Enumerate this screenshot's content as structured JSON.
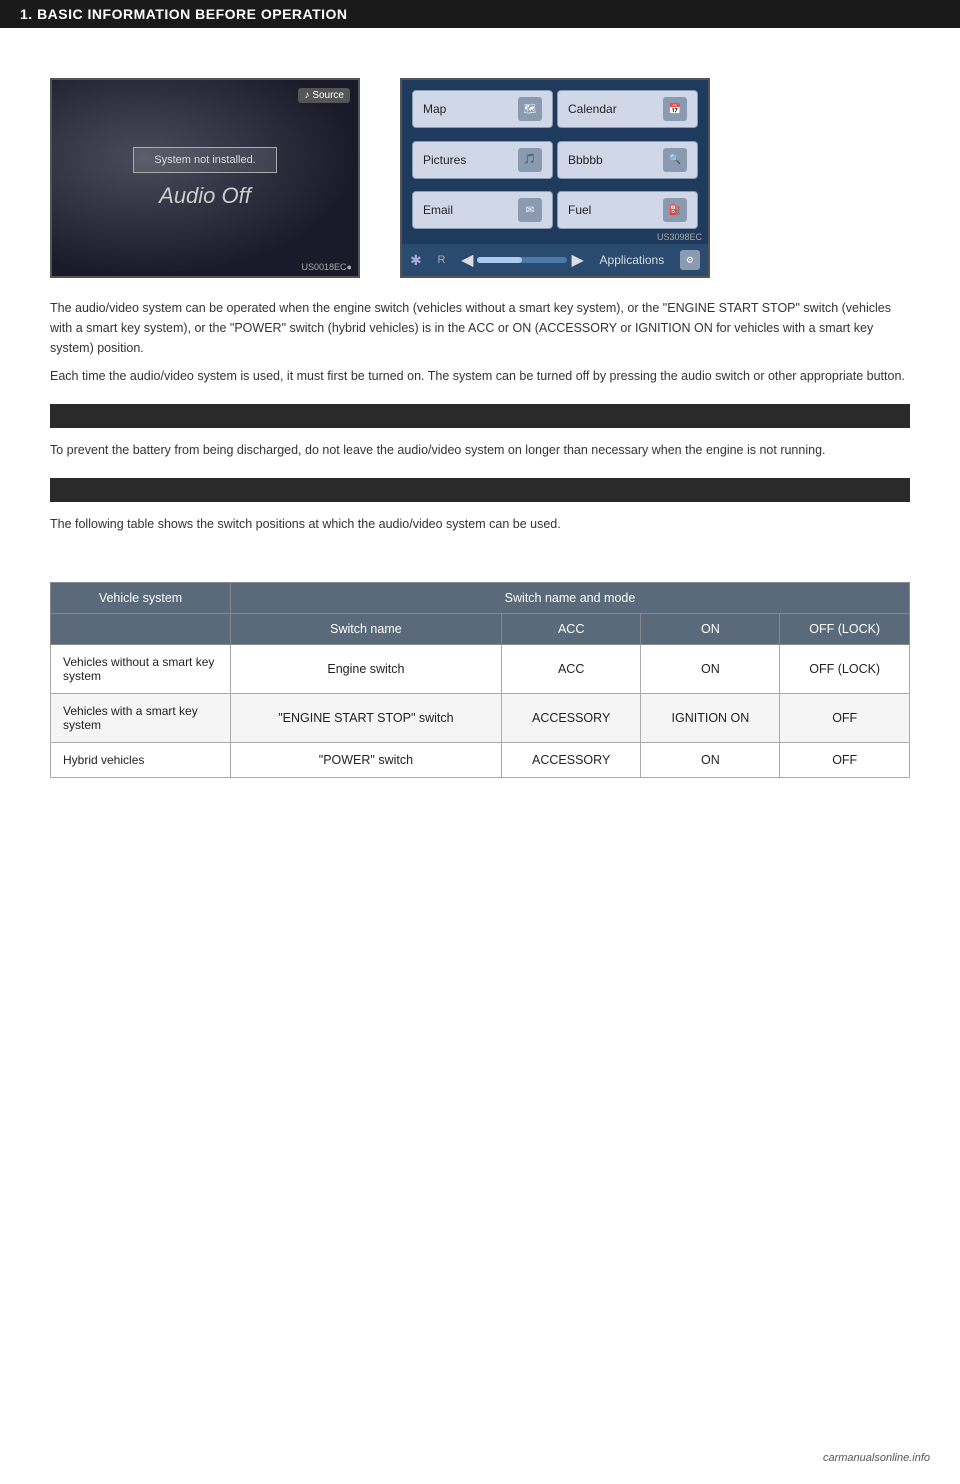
{
  "header": {
    "title": "1. BASIC INFORMATION BEFORE OPERATION"
  },
  "screenshots": {
    "left": {
      "code": "US0018EC●",
      "source_label": "Source",
      "system_not_installed": "System not installed.",
      "audio_off": "Audio Off"
    },
    "right": {
      "code": "US3098EC",
      "apps": [
        {
          "label": "Map",
          "icon": "🗺"
        },
        {
          "label": "Calendar",
          "icon": "📅"
        },
        {
          "label": "Pictures",
          "icon": "🎵"
        },
        {
          "label": "Bbbbb",
          "icon": "🔍"
        },
        {
          "label": "Email",
          "icon": "✉"
        },
        {
          "label": "Fuel",
          "icon": "⛽"
        }
      ],
      "bottom_label": "Applications"
    }
  },
  "section1": {
    "bar": "",
    "paragraphs": [
      "The audio/video system can be operated when the engine switch (vehicles without a smart key system), or the \"ENGINE START STOP\" switch (vehicles with a smart key system), or the \"POWER\" switch (hybrid vehicles) is in the ACC or ON (ACCESSORY or IGNITION ON for vehicles with a smart key system) position.",
      "Each time the audio/video system is used, it must first be turned on. The system can be turned off by pressing the audio switch or other appropriate button."
    ]
  },
  "section2": {
    "bar": "",
    "paragraphs": [
      "To prevent the battery from being discharged, do not leave the audio/video system on longer than necessary when the engine is not running."
    ]
  },
  "table": {
    "headers": [
      "Vehicle system",
      "Switch name and mode"
    ],
    "subheaders": [
      "",
      "",
      "ACC",
      "ON",
      "OFF (LOCK)"
    ],
    "rows": [
      {
        "vehicle_system": "Vehicles without a smart key system",
        "switch_name": "Engine switch",
        "col1": "ACC",
        "col2": "ON",
        "col3": "OFF (LOCK)"
      },
      {
        "vehicle_system": "Vehicles with a smart key system",
        "switch_name": "\"ENGINE START STOP\" switch",
        "col1": "ACCESSORY",
        "col2": "IGNITION ON",
        "col3": "OFF"
      },
      {
        "vehicle_system": "Hybrid vehicles",
        "switch_name": "\"POWER\" switch",
        "col1": "ACCESSORY",
        "col2": "ON",
        "col3": "OFF"
      }
    ]
  },
  "footer": {
    "logo": "carmanualsonline.info"
  }
}
